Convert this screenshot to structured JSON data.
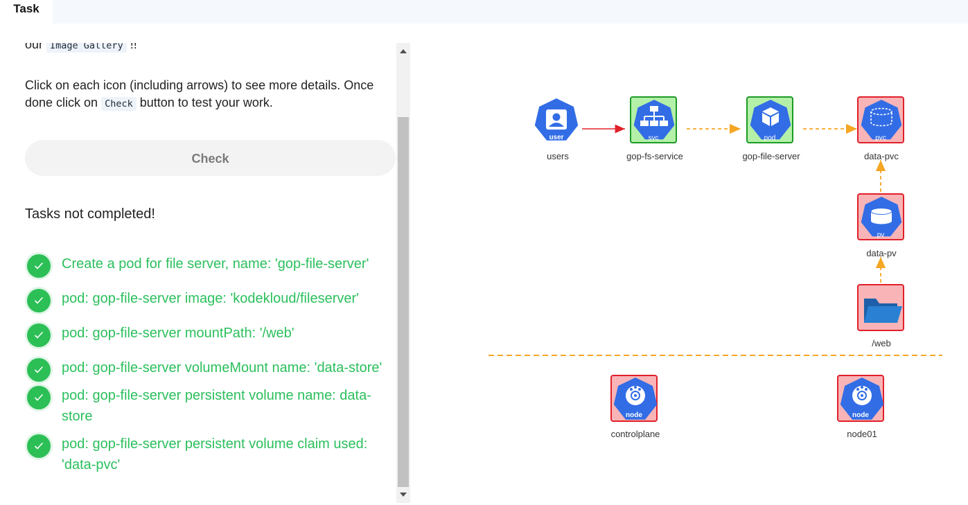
{
  "tabs": {
    "task": "Task"
  },
  "intro": {
    "prefix": "our",
    "chip": "Image Gallery",
    "suffix": "!!",
    "instr_line": "Click on each icon (including arrows) to see more details. Once done click on",
    "instr_chip": "Check",
    "instr_end": "button to test your work."
  },
  "check_button": "Check",
  "status_title": "Tasks not completed!",
  "tasks": [
    "Create a pod for file server, name: 'gop-file-server'",
    "pod: gop-file-server image: 'kodekloud/fileserver'",
    "pod: gop-file-server mountPath: '/web'",
    "pod: gop-file-server volumeMount name: 'data-store'",
    "pod: gop-file-server persistent volume name: data-store",
    "pod: gop-file-server persistent volume claim used: 'data-pvc'"
  ],
  "diagram": {
    "users": {
      "icon_text": "user",
      "label": "users"
    },
    "service": {
      "icon_text": "svc",
      "label": "gop-fs-service",
      "status": "ok"
    },
    "pod": {
      "icon_text": "pod",
      "label": "gop-file-server",
      "status": "ok"
    },
    "pvc": {
      "icon_text": "pvc",
      "label": "data-pvc",
      "status": "missing"
    },
    "pv": {
      "icon_text": "pv",
      "label": "data-pv",
      "status": "missing"
    },
    "web": {
      "label": "/web",
      "status": "missing"
    },
    "controlplane": {
      "icon_text": "node",
      "label": "controlplane"
    },
    "node01": {
      "icon_text": "node",
      "label": "node01"
    }
  },
  "colors": {
    "k8s_blue": "#326de6",
    "ok_fill": "#b4f0a8",
    "ok_border": "#1c9a25",
    "missing_fill": "#f8b4b6",
    "missing_border": "#e0202a",
    "link_orange": "#f5a623",
    "link_red": "#e0202a",
    "task_green": "#2bbf5c"
  }
}
